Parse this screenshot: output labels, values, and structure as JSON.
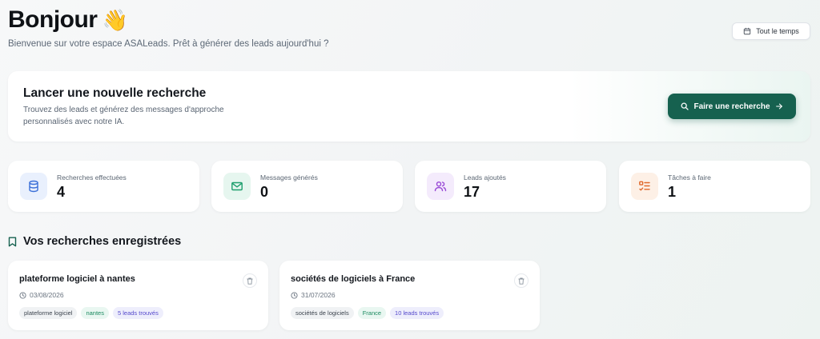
{
  "header": {
    "greeting": "Bonjour",
    "wave_emoji": "👋",
    "subtitle": "Bienvenue sur votre espace ASALeads. Prêt à générer des leads aujourd'hui ?",
    "period_label": "Tout le temps",
    "period_icon": "calendar-icon"
  },
  "hero": {
    "title": "Lancer une nouvelle recherche",
    "description": "Trouvez des leads et générez des messages d'approche personnalisés avec notre IA.",
    "button_label": "Faire une recherche",
    "button_color": "#16614f"
  },
  "stats": [
    {
      "label": "Recherches effectuées",
      "value": "4",
      "icon": "database-icon",
      "color": "#3a6fd8",
      "bg": "#e9f0fd"
    },
    {
      "label": "Messages générés",
      "value": "0",
      "icon": "mail-icon",
      "color": "#1e9f6e",
      "bg": "#e6f6ef"
    },
    {
      "label": "Leads ajoutés",
      "value": "17",
      "icon": "users-icon",
      "color": "#9a4bd6",
      "bg": "#f4ebfc"
    },
    {
      "label": "Tâches à faire",
      "value": "1",
      "icon": "task-list-icon",
      "color": "#e0682a",
      "bg": "#fdf0e6"
    }
  ],
  "saved": {
    "title": "Vos recherches enregistrées",
    "cards": [
      {
        "title": "plateforme logiciel à nantes",
        "date": "03/08/2026",
        "tags": [
          "plateforme logiciel",
          "nantes",
          "5 leads trouvés"
        ]
      },
      {
        "title": "sociétés de logiciels à France",
        "date": "31/07/2026",
        "tags": [
          "sociétés de logiciels",
          "France",
          "10 leads trouvés"
        ]
      }
    ]
  }
}
